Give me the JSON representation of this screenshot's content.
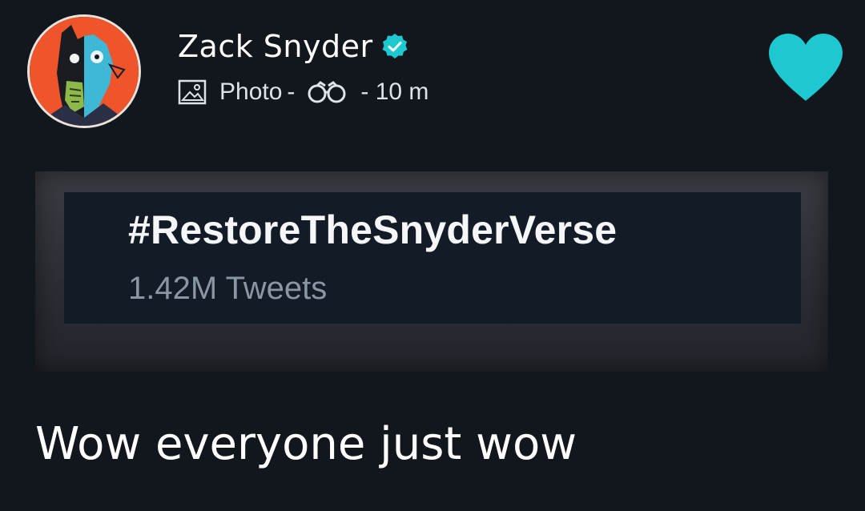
{
  "post": {
    "author_name": "Zack Snyder",
    "verified": true,
    "meta": {
      "type_label": "Photo",
      "separator": "-",
      "time": "- 10 m"
    },
    "liked": true
  },
  "trend": {
    "hashtag": "#RestoreTheSnyderVerse",
    "count": "1.42M Tweets"
  },
  "caption": "Wow everyone just wow",
  "icons": {
    "avatar": "avatar-illustration",
    "verified": "verified-check-icon",
    "photo": "photo-icon",
    "views": "binoculars-icon",
    "like": "heart-icon"
  },
  "colors": {
    "background": "#12161d",
    "accent": "#1ec8d0",
    "avatar_bg": "#f0542a",
    "muted_text": "#8b96a4"
  }
}
